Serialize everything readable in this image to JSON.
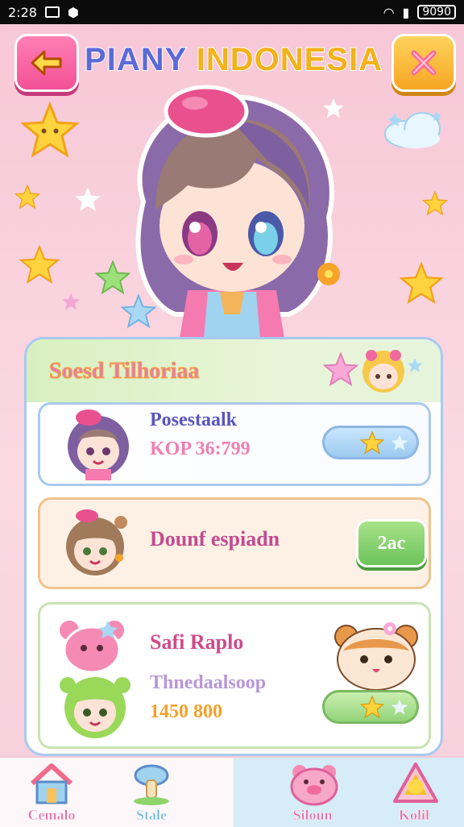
{
  "status_bar": {
    "time": "2:28",
    "battery": "9090"
  },
  "header": {
    "title_part1": "PIANY",
    "title_part2": "INDONESIA"
  },
  "panel": {
    "title": "Soesd Tilhoriaa",
    "cards": [
      {
        "name": "Posestaalk",
        "subtitle": "KOP 36:799"
      },
      {
        "name": "Dounf espiadn",
        "button_label": "2ac"
      },
      {
        "name": "Safi Raplo",
        "subtitle": "Thnedaalsoop",
        "value": "1450 800"
      }
    ]
  },
  "bottom_nav": {
    "items": [
      {
        "label": "Cemalo",
        "icon": "house-icon"
      },
      {
        "label": "Stale",
        "icon": "mushroom-icon"
      },
      {
        "label": "Siloun",
        "icon": "pig-icon"
      },
      {
        "label": "Kolil",
        "icon": "gem-icon"
      }
    ],
    "active_index": 2
  },
  "colors": {
    "accent_pink": "#f25096",
    "accent_yellow": "#f5a623",
    "title_blue": "#5b6ad8",
    "title_gold": "#f2b21a"
  }
}
